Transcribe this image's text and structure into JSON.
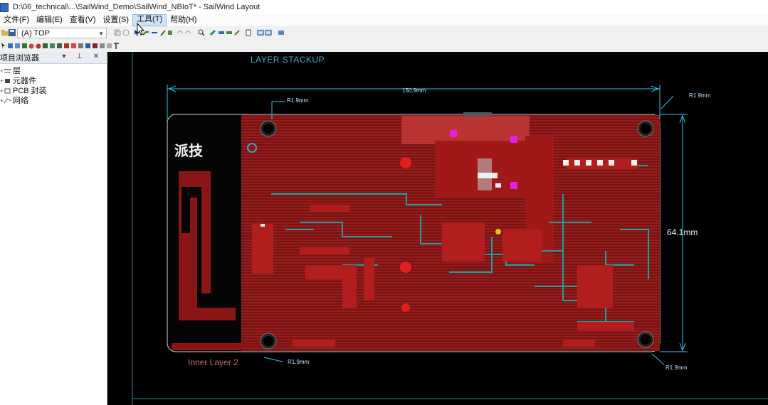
{
  "window": {
    "title": "D:\\06_technical\\...\\SailWind_Demo\\SailWind_NBIoT* - SailWind Layout"
  },
  "menu": {
    "items": [
      {
        "label": "文件(F)"
      },
      {
        "label": "编辑(E)"
      },
      {
        "label": "查看(V)"
      },
      {
        "label": "设置(S)"
      },
      {
        "label": "工具(T)"
      },
      {
        "label": "帮助(H)"
      }
    ]
  },
  "toolbar": {
    "layer_value": "(A) TOP"
  },
  "panel": {
    "title": "项目浏览器",
    "controls": "▾ ⊥ ✕",
    "tree": [
      {
        "label": "层"
      },
      {
        "label": "元器件"
      },
      {
        "label": "PCB 封装"
      },
      {
        "label": "网络"
      }
    ]
  },
  "canvas": {
    "stackup_label": "LAYER STACKUP",
    "width_dim": "150.9mm",
    "height_dim": "64.1mm",
    "corner_radius_tl": "R1.9mm",
    "corner_radius_tr": "R1.9mm",
    "corner_radius_bl": "R1.9mm",
    "corner_radius_br": "R1.9mm",
    "brand_text": "派技",
    "layer_caption": "Inner Layer 2",
    "colors": {
      "background": "#000000",
      "copper": "#8b1414",
      "trace_cyan": "#1f9ea0",
      "dimension": "#27c7e6",
      "pad_magenta": "#e61ee6"
    }
  }
}
